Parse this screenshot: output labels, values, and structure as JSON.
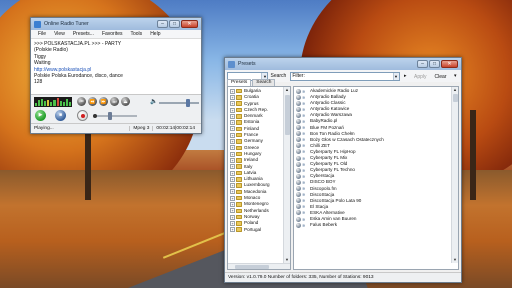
{
  "radio_window": {
    "title": "Online Radio Tuner",
    "menu": [
      "File",
      "View",
      "Presets...",
      "Favorites",
      "Tools",
      "Help"
    ],
    "info_lines": [
      ">>> POLSKASTACJA.PL >>> - PARTY",
      "(Polskie Radio)",
      "Tiggy",
      "Waiting",
      "http://www.polskastacja.pl",
      "Polskie Polska Eurodance, disco, dance",
      "128"
    ],
    "status": {
      "text": "Playing...",
      "format": "Mpeg 3",
      "time": "00:02:14|00:02:14"
    },
    "volume_level": 0.75,
    "seek_position": 0.35
  },
  "presets_window": {
    "title": "Presets",
    "toolbar": {
      "search_label": "Search",
      "filter_placeholder": "Filter:",
      "apply_label": "Apply",
      "clear_label": "Clear"
    },
    "tabs": [
      "Presets",
      "Search"
    ],
    "countries": [
      "Bulgaria",
      "Croatia",
      "Cyprus",
      "Czech Rep.",
      "Denmark",
      "Estonia",
      "Finland",
      "France",
      "Germany",
      "Greece",
      "Hungary",
      "Ireland",
      "Italy",
      "Latvia",
      "Lithuania",
      "Luxembourg",
      "Macedonia",
      "Monaco",
      "Montenegro",
      "Netherlands",
      "Norway",
      "Poland",
      "Portugal"
    ],
    "stations": [
      "Akademickie Radio Luz",
      "Antyradio Ballady",
      "Antyradio Classic",
      "Antyradio Katowice",
      "Antyradio Warszawa",
      "BabyRadio.pl",
      "Blue FM Poznań",
      "Bon Ton Radio Chełm",
      "Boży Głos w Czasach Ostatecznych",
      "Chilli ZET",
      "Cyberparty FL HipHop",
      "Cyberparty FL Mix",
      "Cyberparty FL Old",
      "Cyberparty FL Techno",
      "Cyberstacja",
      "DISCO BOY",
      "Discopolo.fm",
      "DiscoStacja",
      "DiscoStacja Polo Lata 90",
      "El Stacja",
      "ESKA Alternative",
      "Eska Amin van Buuren",
      "Falus Beberk"
    ],
    "status": "Version: v1.0.79.0  Number of folders: 335, Number of Stations: 9013"
  }
}
